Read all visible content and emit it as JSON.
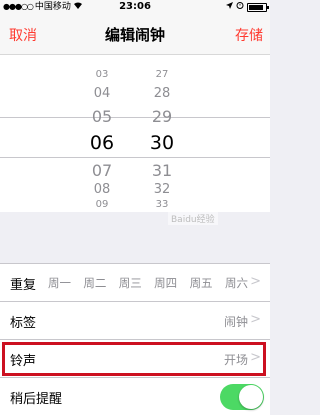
{
  "status_bar": {
    "carrier": "中国移动",
    "time": "23:06",
    "battery_level": 0.85
  },
  "nav": {
    "cancel": "取消",
    "title": "编辑闹钟",
    "save": "存储"
  },
  "picker": {
    "hours": [
      "03",
      "04",
      "05",
      "06",
      "07",
      "08",
      "09"
    ],
    "minutes": [
      "27",
      "28",
      "29",
      "30",
      "31",
      "32",
      "33"
    ],
    "selected_hour": "06",
    "selected_minute": "30"
  },
  "settings": {
    "repeat": {
      "label": "重复",
      "days": [
        "周一",
        "周二",
        "周三",
        "周四",
        "周五",
        "周六"
      ]
    },
    "label": {
      "label": "标签",
      "value": "闹钟"
    },
    "sound": {
      "label": "铃声",
      "value": "开场"
    },
    "snooze": {
      "label": "稍后提醒",
      "enabled": true
    }
  },
  "icons": {
    "signal": "signal-dots-icon",
    "wifi": "wifi-icon",
    "location": "location-arrow-icon",
    "alarm": "alarm-clock-icon",
    "battery": "battery-icon",
    "chevron": "chevron-right-icon"
  },
  "colors": {
    "accent": "#ff3b30",
    "toggle_on": "#4cd964",
    "highlight": "#cc1020"
  },
  "watermark": "Baidu经验"
}
